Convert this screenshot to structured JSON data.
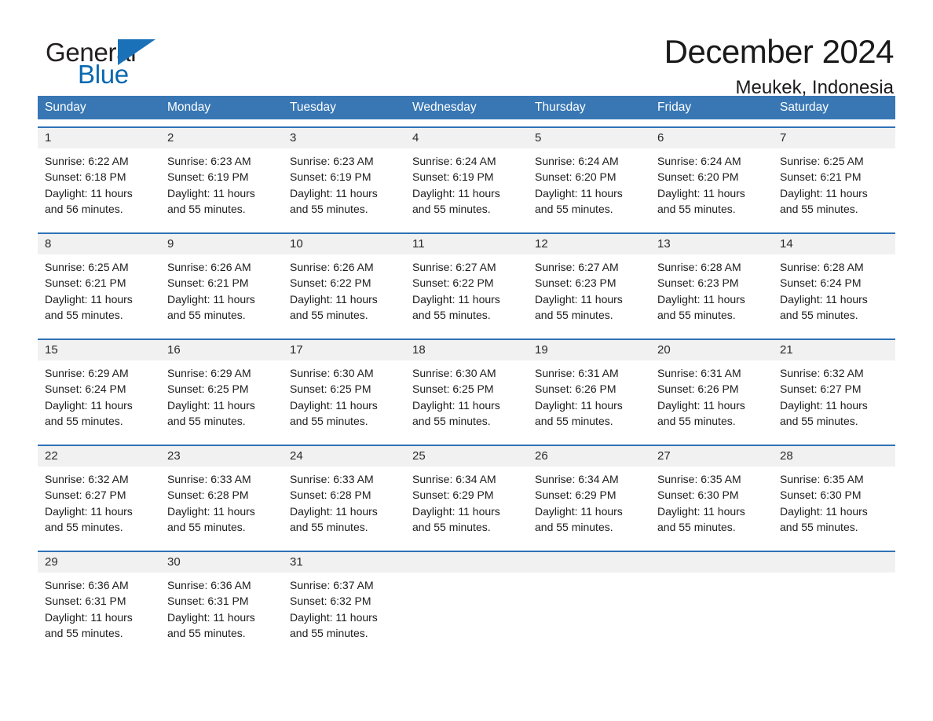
{
  "brand": {
    "word_one": "General",
    "word_two": "Blue",
    "triangle_color": "#1a71b8",
    "blue_color": "#0a68b0"
  },
  "header": {
    "month_title": "December 2024",
    "location": "Meukek, Indonesia"
  },
  "theme": {
    "header_blue": "#3877b4",
    "rule_blue": "#2e72b6",
    "daynum_band": "#f1f1f1"
  },
  "calendar": {
    "weekday_headers": [
      "Sunday",
      "Monday",
      "Tuesday",
      "Wednesday",
      "Thursday",
      "Friday",
      "Saturday"
    ],
    "weeks": [
      [
        {
          "day": "1",
          "sunrise": "Sunrise: 6:22 AM",
          "sunset": "Sunset: 6:18 PM",
          "daylight_line1": "Daylight: 11 hours",
          "daylight_line2": "and 56 minutes."
        },
        {
          "day": "2",
          "sunrise": "Sunrise: 6:23 AM",
          "sunset": "Sunset: 6:19 PM",
          "daylight_line1": "Daylight: 11 hours",
          "daylight_line2": "and 55 minutes."
        },
        {
          "day": "3",
          "sunrise": "Sunrise: 6:23 AM",
          "sunset": "Sunset: 6:19 PM",
          "daylight_line1": "Daylight: 11 hours",
          "daylight_line2": "and 55 minutes."
        },
        {
          "day": "4",
          "sunrise": "Sunrise: 6:24 AM",
          "sunset": "Sunset: 6:19 PM",
          "daylight_line1": "Daylight: 11 hours",
          "daylight_line2": "and 55 minutes."
        },
        {
          "day": "5",
          "sunrise": "Sunrise: 6:24 AM",
          "sunset": "Sunset: 6:20 PM",
          "daylight_line1": "Daylight: 11 hours",
          "daylight_line2": "and 55 minutes."
        },
        {
          "day": "6",
          "sunrise": "Sunrise: 6:24 AM",
          "sunset": "Sunset: 6:20 PM",
          "daylight_line1": "Daylight: 11 hours",
          "daylight_line2": "and 55 minutes."
        },
        {
          "day": "7",
          "sunrise": "Sunrise: 6:25 AM",
          "sunset": "Sunset: 6:21 PM",
          "daylight_line1": "Daylight: 11 hours",
          "daylight_line2": "and 55 minutes."
        }
      ],
      [
        {
          "day": "8",
          "sunrise": "Sunrise: 6:25 AM",
          "sunset": "Sunset: 6:21 PM",
          "daylight_line1": "Daylight: 11 hours",
          "daylight_line2": "and 55 minutes."
        },
        {
          "day": "9",
          "sunrise": "Sunrise: 6:26 AM",
          "sunset": "Sunset: 6:21 PM",
          "daylight_line1": "Daylight: 11 hours",
          "daylight_line2": "and 55 minutes."
        },
        {
          "day": "10",
          "sunrise": "Sunrise: 6:26 AM",
          "sunset": "Sunset: 6:22 PM",
          "daylight_line1": "Daylight: 11 hours",
          "daylight_line2": "and 55 minutes."
        },
        {
          "day": "11",
          "sunrise": "Sunrise: 6:27 AM",
          "sunset": "Sunset: 6:22 PM",
          "daylight_line1": "Daylight: 11 hours",
          "daylight_line2": "and 55 minutes."
        },
        {
          "day": "12",
          "sunrise": "Sunrise: 6:27 AM",
          "sunset": "Sunset: 6:23 PM",
          "daylight_line1": "Daylight: 11 hours",
          "daylight_line2": "and 55 minutes."
        },
        {
          "day": "13",
          "sunrise": "Sunrise: 6:28 AM",
          "sunset": "Sunset: 6:23 PM",
          "daylight_line1": "Daylight: 11 hours",
          "daylight_line2": "and 55 minutes."
        },
        {
          "day": "14",
          "sunrise": "Sunrise: 6:28 AM",
          "sunset": "Sunset: 6:24 PM",
          "daylight_line1": "Daylight: 11 hours",
          "daylight_line2": "and 55 minutes."
        }
      ],
      [
        {
          "day": "15",
          "sunrise": "Sunrise: 6:29 AM",
          "sunset": "Sunset: 6:24 PM",
          "daylight_line1": "Daylight: 11 hours",
          "daylight_line2": "and 55 minutes."
        },
        {
          "day": "16",
          "sunrise": "Sunrise: 6:29 AM",
          "sunset": "Sunset: 6:25 PM",
          "daylight_line1": "Daylight: 11 hours",
          "daylight_line2": "and 55 minutes."
        },
        {
          "day": "17",
          "sunrise": "Sunrise: 6:30 AM",
          "sunset": "Sunset: 6:25 PM",
          "daylight_line1": "Daylight: 11 hours",
          "daylight_line2": "and 55 minutes."
        },
        {
          "day": "18",
          "sunrise": "Sunrise: 6:30 AM",
          "sunset": "Sunset: 6:25 PM",
          "daylight_line1": "Daylight: 11 hours",
          "daylight_line2": "and 55 minutes."
        },
        {
          "day": "19",
          "sunrise": "Sunrise: 6:31 AM",
          "sunset": "Sunset: 6:26 PM",
          "daylight_line1": "Daylight: 11 hours",
          "daylight_line2": "and 55 minutes."
        },
        {
          "day": "20",
          "sunrise": "Sunrise: 6:31 AM",
          "sunset": "Sunset: 6:26 PM",
          "daylight_line1": "Daylight: 11 hours",
          "daylight_line2": "and 55 minutes."
        },
        {
          "day": "21",
          "sunrise": "Sunrise: 6:32 AM",
          "sunset": "Sunset: 6:27 PM",
          "daylight_line1": "Daylight: 11 hours",
          "daylight_line2": "and 55 minutes."
        }
      ],
      [
        {
          "day": "22",
          "sunrise": "Sunrise: 6:32 AM",
          "sunset": "Sunset: 6:27 PM",
          "daylight_line1": "Daylight: 11 hours",
          "daylight_line2": "and 55 minutes."
        },
        {
          "day": "23",
          "sunrise": "Sunrise: 6:33 AM",
          "sunset": "Sunset: 6:28 PM",
          "daylight_line1": "Daylight: 11 hours",
          "daylight_line2": "and 55 minutes."
        },
        {
          "day": "24",
          "sunrise": "Sunrise: 6:33 AM",
          "sunset": "Sunset: 6:28 PM",
          "daylight_line1": "Daylight: 11 hours",
          "daylight_line2": "and 55 minutes."
        },
        {
          "day": "25",
          "sunrise": "Sunrise: 6:34 AM",
          "sunset": "Sunset: 6:29 PM",
          "daylight_line1": "Daylight: 11 hours",
          "daylight_line2": "and 55 minutes."
        },
        {
          "day": "26",
          "sunrise": "Sunrise: 6:34 AM",
          "sunset": "Sunset: 6:29 PM",
          "daylight_line1": "Daylight: 11 hours",
          "daylight_line2": "and 55 minutes."
        },
        {
          "day": "27",
          "sunrise": "Sunrise: 6:35 AM",
          "sunset": "Sunset: 6:30 PM",
          "daylight_line1": "Daylight: 11 hours",
          "daylight_line2": "and 55 minutes."
        },
        {
          "day": "28",
          "sunrise": "Sunrise: 6:35 AM",
          "sunset": "Sunset: 6:30 PM",
          "daylight_line1": "Daylight: 11 hours",
          "daylight_line2": "and 55 minutes."
        }
      ],
      [
        {
          "day": "29",
          "sunrise": "Sunrise: 6:36 AM",
          "sunset": "Sunset: 6:31 PM",
          "daylight_line1": "Daylight: 11 hours",
          "daylight_line2": "and 55 minutes."
        },
        {
          "day": "30",
          "sunrise": "Sunrise: 6:36 AM",
          "sunset": "Sunset: 6:31 PM",
          "daylight_line1": "Daylight: 11 hours",
          "daylight_line2": "and 55 minutes."
        },
        {
          "day": "31",
          "sunrise": "Sunrise: 6:37 AM",
          "sunset": "Sunset: 6:32 PM",
          "daylight_line1": "Daylight: 11 hours",
          "daylight_line2": "and 55 minutes."
        },
        {
          "day": "",
          "sunrise": "",
          "sunset": "",
          "daylight_line1": "",
          "daylight_line2": ""
        },
        {
          "day": "",
          "sunrise": "",
          "sunset": "",
          "daylight_line1": "",
          "daylight_line2": ""
        },
        {
          "day": "",
          "sunrise": "",
          "sunset": "",
          "daylight_line1": "",
          "daylight_line2": ""
        },
        {
          "day": "",
          "sunrise": "",
          "sunset": "",
          "daylight_line1": "",
          "daylight_line2": ""
        }
      ]
    ]
  }
}
